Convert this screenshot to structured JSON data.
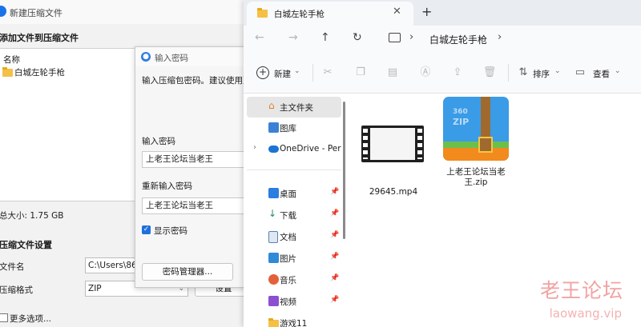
{
  "zip_window": {
    "title": "新建压缩文件",
    "add_section": "添加文件到压缩文件",
    "list_header": "名称",
    "list_items": [
      {
        "name": "白城左轮手枪"
      }
    ],
    "total_size": "总大小: 1.75 GB",
    "settings_section": "压缩文件设置",
    "filename_label": "文件名",
    "filename_value": "C:\\Users\\86",
    "format_label": "压缩格式",
    "format_value": "ZIP",
    "more_options": "更多选项...",
    "settings_button": "设置"
  },
  "password_dialog": {
    "title": "输入密码",
    "instruction": "输入压缩包密码。建议使用至",
    "enter_label": "输入密码",
    "enter_value": "上老王论坛当老王",
    "reenter_label": "重新输入密码",
    "reenter_value": "上老王论坛当老王",
    "show_password_label": "显示密码",
    "show_password_checked": true,
    "manager_button": "密码管理器..."
  },
  "explorer": {
    "tab_title": "白城左轮手枪",
    "new_tab": "+",
    "breadcrumb": [
      "白城左轮手枪"
    ],
    "toolbar": {
      "new_label": "新建",
      "sort_label": "排序",
      "view_label": "查看"
    },
    "nav": {
      "home": "主文件夹",
      "gallery": "图库",
      "onedrive": "OneDrive - Per",
      "pinned": [
        {
          "label": "桌面",
          "icon": "desktop-icon",
          "color": "#2a7de1"
        },
        {
          "label": "下载",
          "icon": "download-icon",
          "color": "#1f8a5a"
        },
        {
          "label": "文档",
          "icon": "document-icon",
          "color": "#5a7fb0"
        },
        {
          "label": "图片",
          "icon": "pictures-icon",
          "color": "#2f8ad8"
        },
        {
          "label": "音乐",
          "icon": "music-icon",
          "color": "#e2613a"
        },
        {
          "label": "视频",
          "icon": "video-icon",
          "color": "#8c4fd0"
        },
        {
          "label": "游戏11",
          "icon": "folder-icon",
          "color": "#f4c046"
        }
      ]
    },
    "files": [
      {
        "name": "29645.mp4",
        "type": "video"
      },
      {
        "name_line1": "上老王论坛当老",
        "name_line2": "王.zip",
        "type": "zip",
        "zip_brand": "360",
        "zip_text": "ZIP"
      }
    ]
  },
  "watermark": {
    "text": "老王论坛",
    "url": "laowang.vip"
  },
  "colors": {
    "accent": "#1f6fdc",
    "zip_blue": "#3a9be6",
    "zip_green": "#6cc04a",
    "zip_orange": "#f28a1e"
  }
}
